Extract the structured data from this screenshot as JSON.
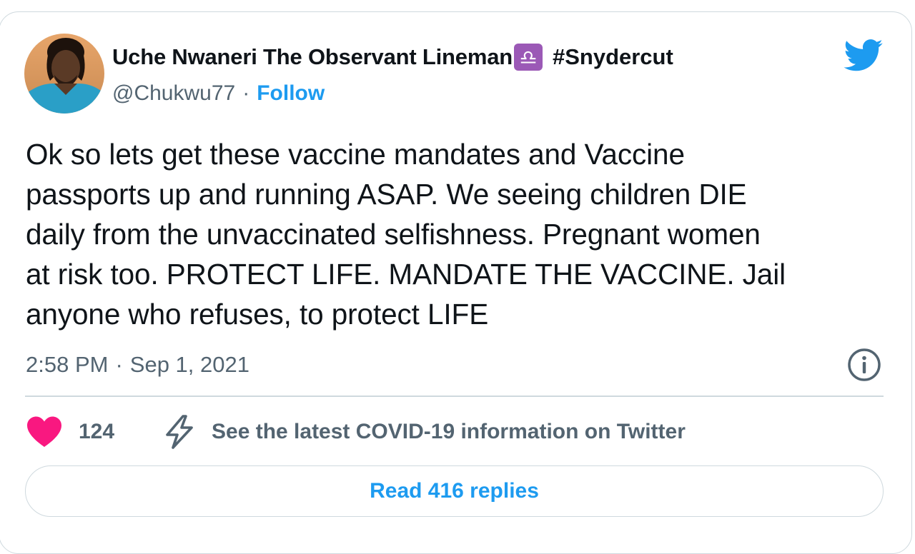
{
  "author": {
    "name": "Uche Nwaneri The Observant Lineman",
    "emoji_symbol": "♎",
    "hashtag": "#Snydercut",
    "handle": "@Chukwu77",
    "separator": "·",
    "follow_label": "Follow",
    "avatar_icon": "avatar-photo"
  },
  "tweet": {
    "lines": [
      "Ok so lets get these vaccine mandates and Vaccine",
      "passports up and running ASAP. We seeing children DIE",
      "daily from the unvaccinated selfishness. Pregnant women",
      "at risk too. PROTECT LIFE. MANDATE THE VACCINE. Jail",
      "anyone who refuses, to protect LIFE"
    ],
    "time": "2:58 PM",
    "separator": "·",
    "date": "Sep 1, 2021"
  },
  "actions": {
    "like_count": "124",
    "covid_info_label": "See the latest COVID-19 information on Twitter",
    "read_replies_label": "Read 416 replies"
  },
  "icons": {
    "brand": "twitter-bird-icon",
    "info": "info-icon",
    "like": "heart-icon",
    "covid": "lightning-bolt-icon"
  },
  "colors": {
    "text": "#0f1419",
    "secondary": "#536471",
    "accent": "#1d9bf0",
    "like": "#f91880",
    "libra_badge": "#9b59b6",
    "border": "#cfd9de"
  }
}
